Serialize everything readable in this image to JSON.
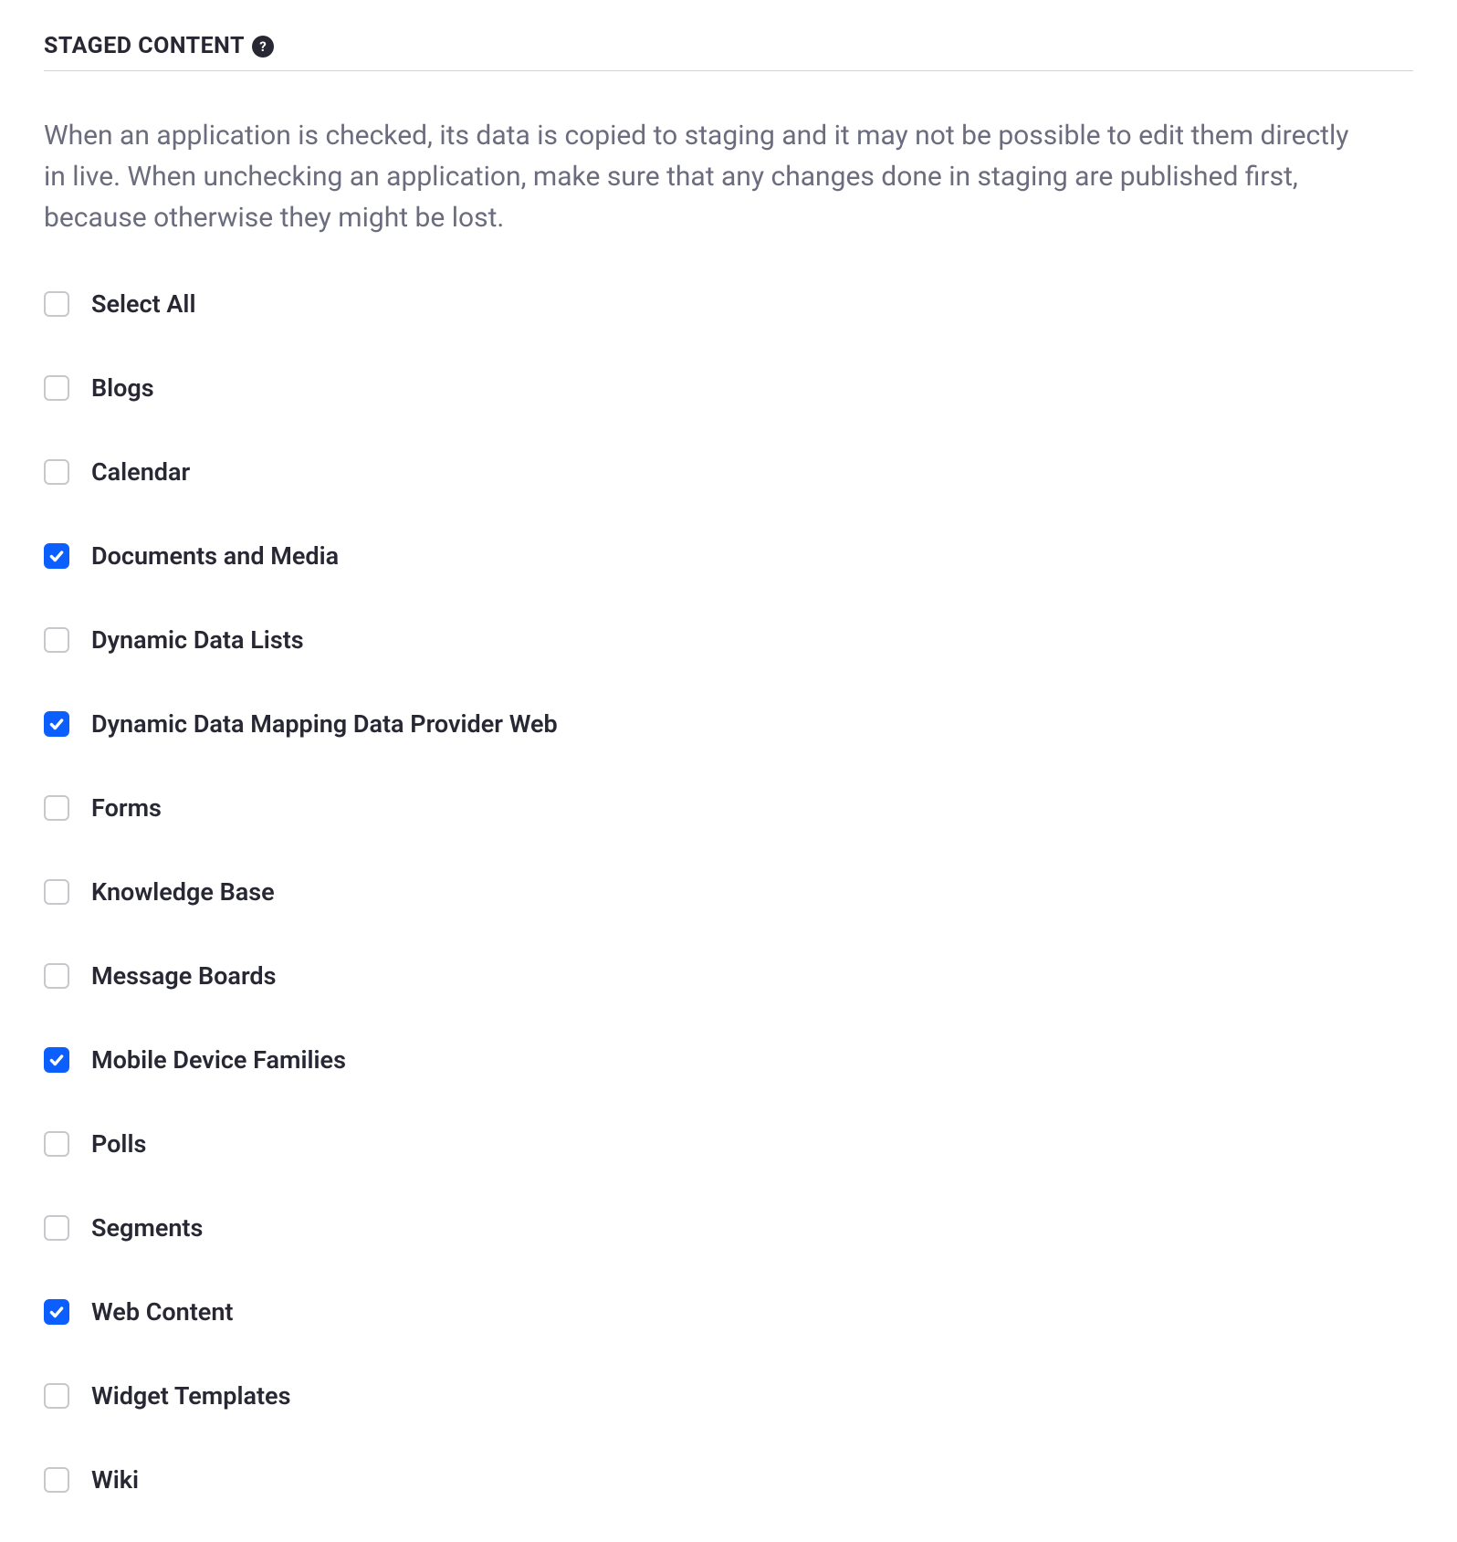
{
  "section": {
    "title": "STAGED CONTENT",
    "description": "When an application is checked, its data is copied to staging and it may not be possible to edit them directly in live. When unchecking an application, make sure that any changes done in staging are published first, because otherwise they might be lost."
  },
  "items": [
    {
      "label": "Select All",
      "checked": false
    },
    {
      "label": "Blogs",
      "checked": false
    },
    {
      "label": "Calendar",
      "checked": false
    },
    {
      "label": "Documents and Media",
      "checked": true
    },
    {
      "label": "Dynamic Data Lists",
      "checked": false
    },
    {
      "label": "Dynamic Data Mapping Data Provider Web",
      "checked": true
    },
    {
      "label": "Forms",
      "checked": false
    },
    {
      "label": "Knowledge Base",
      "checked": false
    },
    {
      "label": "Message Boards",
      "checked": false
    },
    {
      "label": "Mobile Device Families",
      "checked": true
    },
    {
      "label": "Polls",
      "checked": false
    },
    {
      "label": "Segments",
      "checked": false
    },
    {
      "label": "Web Content",
      "checked": true
    },
    {
      "label": "Widget Templates",
      "checked": false
    },
    {
      "label": "Wiki",
      "checked": false
    }
  ]
}
